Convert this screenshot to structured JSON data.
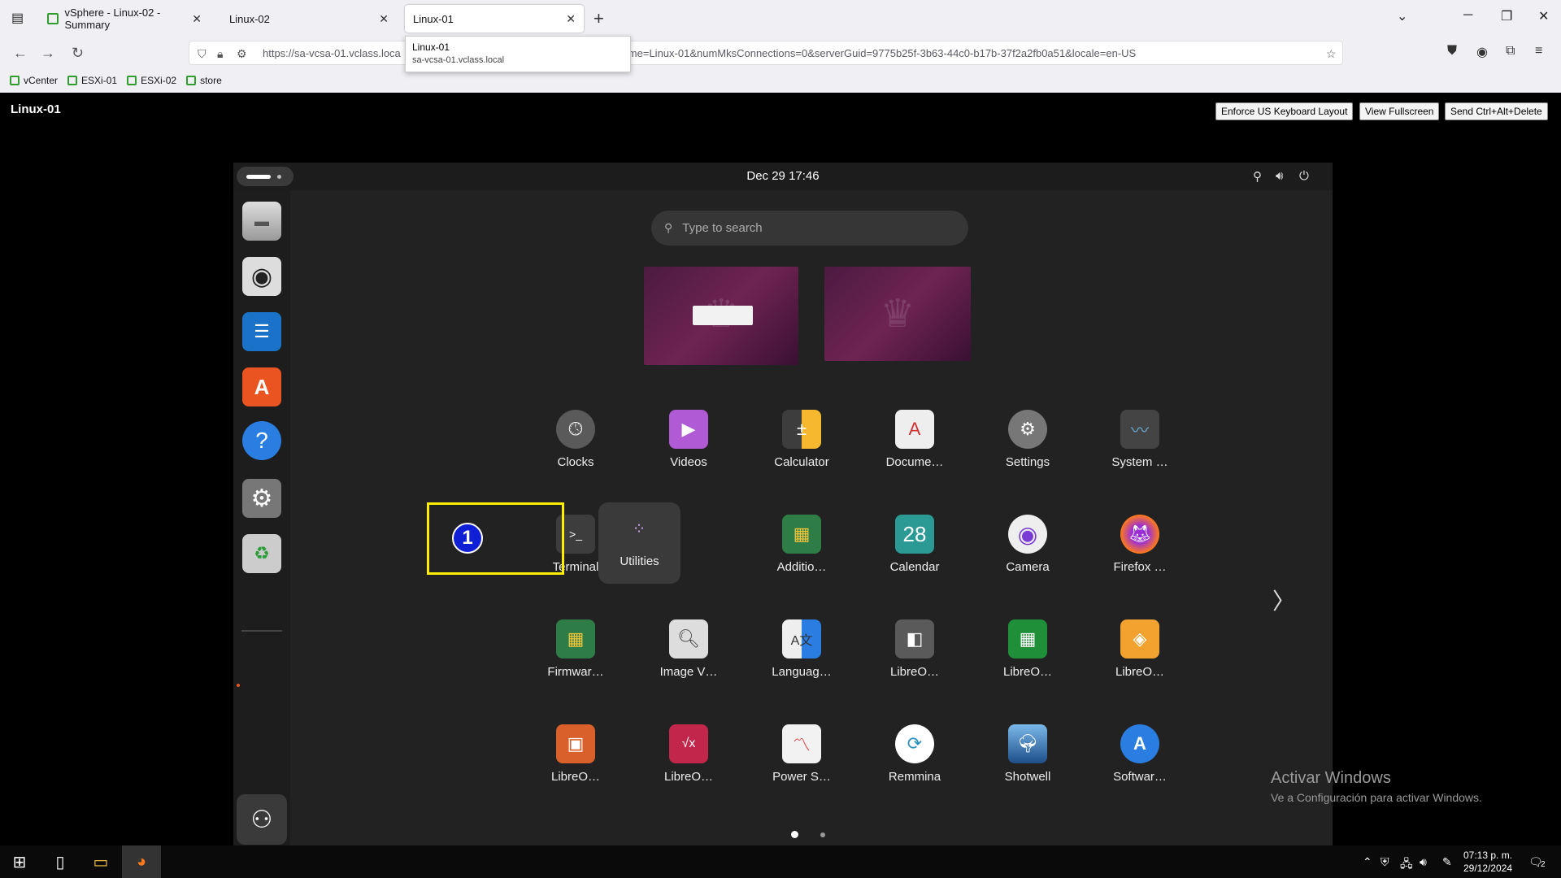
{
  "browser": {
    "tabs": [
      {
        "label": "vSphere - Linux-02 - Summary"
      },
      {
        "label": "Linux-02"
      },
      {
        "label": "Linux-01"
      }
    ],
    "new_tab_icon": "plus-icon",
    "url": "https://sa-vcsa-01.vclass.local/ui/webconsole.html?vmId=vm-...&vmName=Linux-01&numMksConnections=0&serverGuid=9775b25f-3b63-44c0-b17b-37f2a2fb0a51&locale=en-US",
    "url_visible_prefix": "https://sa-vcsa-01.vclass.loca",
    "url_visible_suffix": "me=Linux-01&numMksConnections=0&serverGuid=9775b25f-3b63-44c0-b17b-37f2a2fb0a51&locale=en-US",
    "tooltip": {
      "title": "Linux-01",
      "subtitle": "sa-vcsa-01.vclass.local"
    },
    "bookmarks": [
      {
        "label": "vCenter"
      },
      {
        "label": "ESXi-01"
      },
      {
        "label": "ESXi-02"
      },
      {
        "label": "store"
      }
    ]
  },
  "console": {
    "title": "Linux-01",
    "buttons": {
      "keyboard": "Enforce US Keyboard Layout",
      "fullscreen": "View Fullscreen",
      "cad": "Send Ctrl+Alt+Delete"
    }
  },
  "ubuntu": {
    "datetime": "Dec 29  17:46",
    "search_placeholder": "Type to search",
    "apps": [
      {
        "label": "Clocks",
        "icon": "clock-icon"
      },
      {
        "label": "Videos",
        "icon": "video-icon"
      },
      {
        "label": "Calculator",
        "icon": "calculator-icon"
      },
      {
        "label": "Docume…",
        "icon": "document-viewer-icon"
      },
      {
        "label": "Settings",
        "icon": "settings-icon"
      },
      {
        "label": "System …",
        "icon": "system-monitor-icon"
      },
      {
        "label": "Terminal",
        "icon": "terminal-icon"
      },
      {
        "label": "Utilities",
        "icon": "utilities-folder-icon"
      },
      {
        "label": "Additio…",
        "icon": "additional-drivers-icon"
      },
      {
        "label": "Calendar",
        "icon": "calendar-icon",
        "text": "28"
      },
      {
        "label": "Camera",
        "icon": "camera-icon"
      },
      {
        "label": "Firefox …",
        "icon": "firefox-icon"
      },
      {
        "label": "Firmwar…",
        "icon": "firmware-icon"
      },
      {
        "label": "Image V…",
        "icon": "image-viewer-icon"
      },
      {
        "label": "Languag…",
        "icon": "language-icon"
      },
      {
        "label": "LibreO…",
        "icon": "libreoffice-icon"
      },
      {
        "label": "LibreO…",
        "icon": "libreoffice-calc-icon"
      },
      {
        "label": "LibreO…",
        "icon": "libreoffice-draw-icon"
      },
      {
        "label": "LibreO…",
        "icon": "libreoffice-impress-icon"
      },
      {
        "label": "LibreO…",
        "icon": "libreoffice-math-icon"
      },
      {
        "label": "Power S…",
        "icon": "power-statistics-icon"
      },
      {
        "label": "Remmina",
        "icon": "remmina-icon"
      },
      {
        "label": "Shotwell",
        "icon": "shotwell-icon"
      },
      {
        "label": "Softwar…",
        "icon": "software-icon"
      }
    ],
    "annotation_number": "1"
  },
  "windows": {
    "activate_title": "Activar Windows",
    "activate_sub": "Ve a Configuración para activar Windows.",
    "time": "07:13 p. m.",
    "date": "29/12/2024",
    "notification_count": "2"
  },
  "colors": {
    "ubuntu_orange": "#e95420",
    "highlight_yellow": "#ffee00",
    "annotation_blue": "#0f1fd6"
  }
}
